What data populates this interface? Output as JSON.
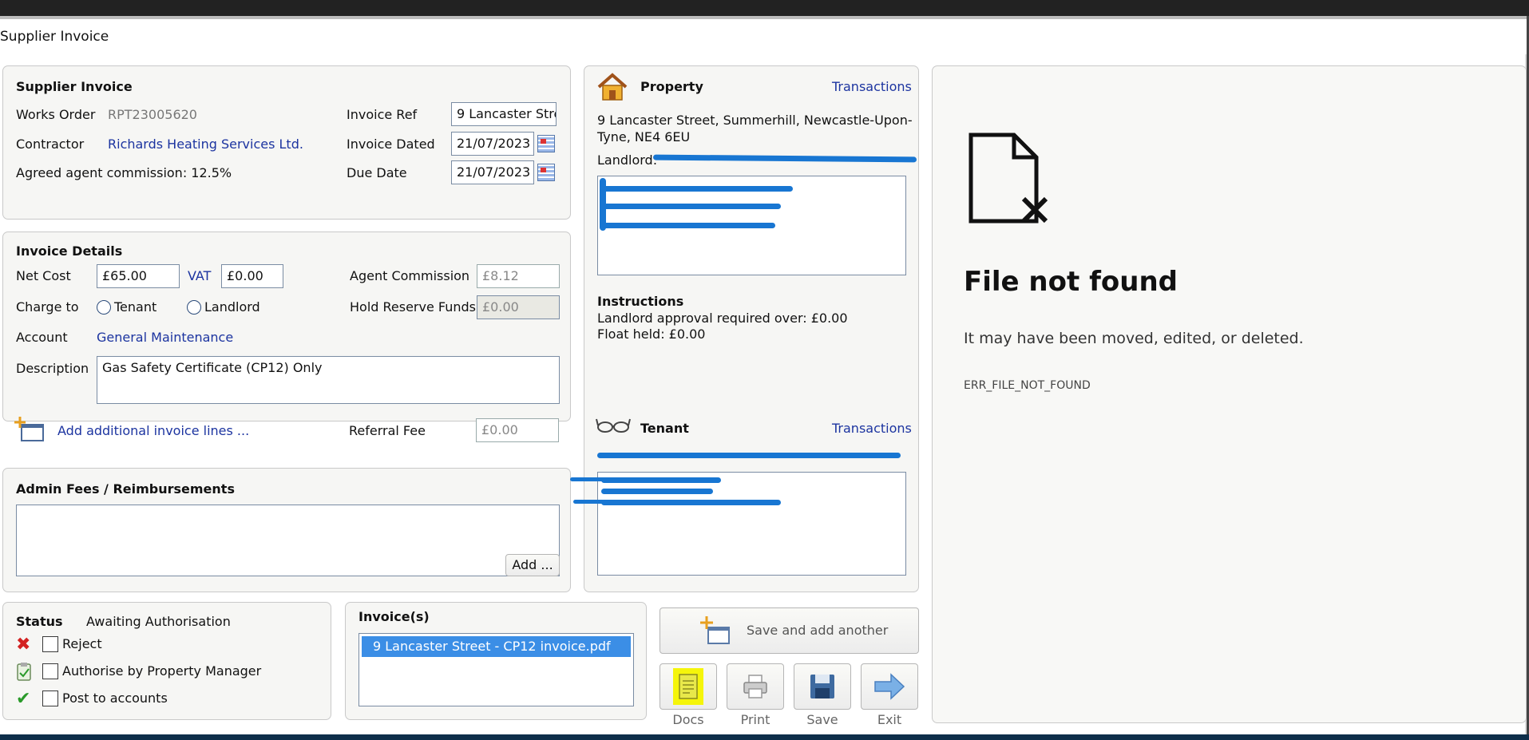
{
  "window": {
    "title": "Supplier Invoice"
  },
  "supplier_invoice": {
    "heading": "Supplier Invoice",
    "works_order_label": "Works Order",
    "works_order_value": "RPT23005620",
    "contractor_label": "Contractor",
    "contractor_value": "Richards Heating Services Ltd.",
    "commission_text": "Agreed agent commission: 12.5%",
    "invoice_ref_label": "Invoice Ref",
    "invoice_ref_value": "9 Lancaster Stre",
    "invoice_dated_label": "Invoice Dated",
    "invoice_dated_value": "21/07/2023",
    "due_date_label": "Due Date",
    "due_date_value": "21/07/2023"
  },
  "invoice_details": {
    "heading": "Invoice Details",
    "net_cost_label": "Net Cost",
    "net_cost_value": "£65.00",
    "vat_label": "VAT",
    "vat_value": "£0.00",
    "agent_commission_label": "Agent Commission",
    "agent_commission_value": "£8.12",
    "charge_to_label": "Charge to",
    "tenant_option": "Tenant",
    "landlord_option": "Landlord",
    "hold_reserve_label": "Hold Reserve Funds",
    "hold_reserve_value": "£0.00",
    "account_label": "Account",
    "account_value": "General Maintenance",
    "description_label": "Description",
    "description_value": "Gas Safety Certificate (CP12) Only",
    "add_lines_link": "Add additional invoice lines ...",
    "referral_fee_label": "Referral Fee",
    "referral_fee_value": "£0.00"
  },
  "admin_fees": {
    "heading": "Admin Fees / Reimbursements",
    "add_button": "Add ..."
  },
  "status": {
    "label": "Status",
    "value": "Awaiting Authorisation",
    "reject_label": "Reject",
    "authorise_label": "Authorise by Property Manager",
    "post_label": "Post to accounts"
  },
  "invoices": {
    "heading": "Invoice(s)",
    "items": [
      "9 Lancaster Street - CP12 invoice.pdf"
    ]
  },
  "actions": {
    "save_add_another": "Save and add another",
    "docs": "Docs",
    "print": "Print",
    "save": "Save",
    "exit": "Exit"
  },
  "property": {
    "heading": "Property",
    "transactions_link": "Transactions",
    "address_line1": "9 Lancaster Street, Summerhill, Newcastle-Upon-",
    "address_line2": "Tyne, NE4 6EU",
    "landlord_label": "Landlord:",
    "instructions_heading": "Instructions",
    "approval_text": "Landlord approval required over: £0.00",
    "float_text": "Float held: £0.00"
  },
  "tenant": {
    "heading": "Tenant",
    "transactions_link": "Transactions"
  },
  "preview": {
    "title": "File not found",
    "message": "It may have been moved, edited, or deleted.",
    "code": "ERR_FILE_NOT_FOUND"
  },
  "colors": {
    "link": "#1c34a0",
    "selection": "#3b8ee6",
    "docs_highlight": "#f5f50a",
    "redaction": "#1876d2"
  }
}
